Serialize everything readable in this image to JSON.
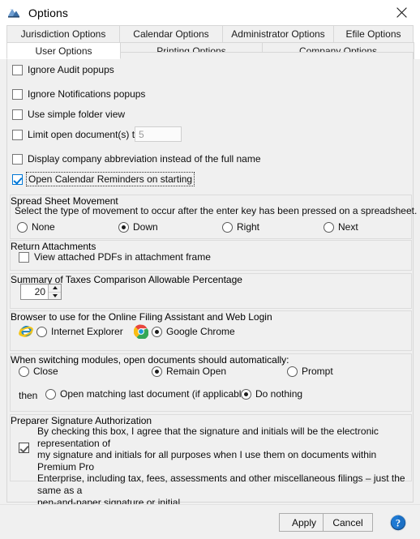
{
  "window": {
    "title": "Options",
    "icon": "app-window-icon",
    "close_icon": "close-icon"
  },
  "tabs": {
    "row1": [
      {
        "label": "Jurisdiction Options",
        "active": false
      },
      {
        "label": "Calendar Options",
        "active": false
      },
      {
        "label": "Administrator Options",
        "active": false
      },
      {
        "label": "Efile Options",
        "active": false
      }
    ],
    "row2": [
      {
        "label": "User Options",
        "active": true
      },
      {
        "label": "Printing Options",
        "active": false
      },
      {
        "label": "Company Options",
        "active": false
      }
    ]
  },
  "user_options": {
    "checkboxes": [
      {
        "label": "Ignore Audit popups",
        "checked": false,
        "focused": false
      },
      {
        "label": "Ignore Notifications popups",
        "checked": false,
        "focused": false
      },
      {
        "label": "Use simple folder view",
        "checked": false,
        "focused": false
      },
      {
        "label": "Limit open document(s) to",
        "checked": false,
        "focused": false
      },
      {
        "label": "Display company abbreviation instead of the full name",
        "checked": false,
        "focused": false
      },
      {
        "label": "Open Calendar Reminders on starting",
        "checked": true,
        "focused": true
      }
    ],
    "limit_open_documents_value": "5"
  },
  "spreadsheet_movement": {
    "title": "Spread Sheet Movement",
    "description": "Select the type of movement to occur after the enter key has been pressed on a spreadsheet.",
    "options": [
      {
        "label": "None",
        "selected": false
      },
      {
        "label": "Down",
        "selected": true
      },
      {
        "label": "Right",
        "selected": false
      },
      {
        "label": "Next",
        "selected": false
      }
    ]
  },
  "return_attachments": {
    "title": "Return Attachments",
    "checkbox": {
      "label": "View attached PDFs in attachment frame",
      "checked": false
    }
  },
  "summary_of_taxes": {
    "title": "Summary of Taxes Comparison Allowable Percentage",
    "value": "20"
  },
  "browser": {
    "title": "Browser to use for the Online Filing Assistant and Web Login",
    "options": [
      {
        "label": "Internet Explorer",
        "selected": false,
        "icon": "internet-explorer-icon"
      },
      {
        "label": "Google Chrome",
        "selected": true,
        "icon": "google-chrome-icon"
      }
    ]
  },
  "switching_modules": {
    "title": "When switching modules, open documents should automatically:",
    "primary_options": [
      {
        "label": "Close",
        "selected": false
      },
      {
        "label": "Remain Open",
        "selected": true
      },
      {
        "label": "Prompt",
        "selected": false
      }
    ],
    "then_label": "then",
    "secondary_options": [
      {
        "label": "Open matching last document (if applicable)",
        "selected": false
      },
      {
        "label": "Do nothing",
        "selected": true
      }
    ]
  },
  "preparer_signature": {
    "title": "Preparer Signature Authorization",
    "checked": true,
    "line1": "By checking this box, I agree that the signature and initials will be the electronic representation of",
    "line2": "my signature and initials for all purposes when I use them on documents within Premium Pro",
    "line3": "Enterprise, including tax, fees, assessments and other miscellaneous filings – just the same as a",
    "line4": "pen-and-paper signature or initial."
  },
  "footer": {
    "apply_label": "Apply",
    "cancel_label": "Cancel",
    "help_icon": "help-icon"
  },
  "colors": {
    "dialog_bg": "#f0f0f0",
    "titlebar_bg": "#ffffff",
    "accent_blue": "#0078d7",
    "group_border": "#dcdcdc",
    "help_blue": "#1f6fc4"
  }
}
